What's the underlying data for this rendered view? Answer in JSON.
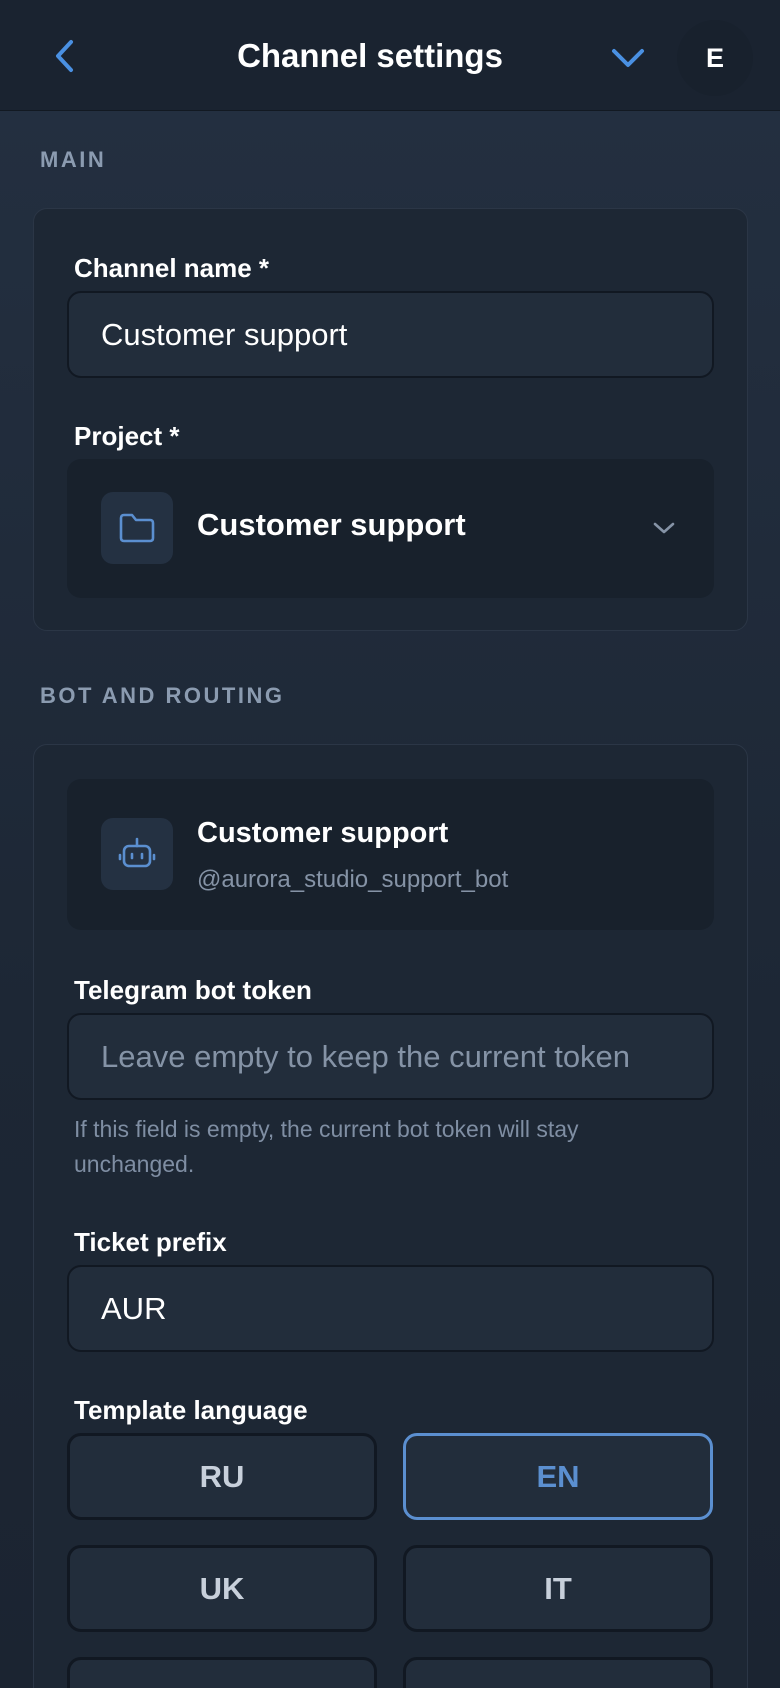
{
  "header": {
    "title": "Channel settings",
    "avatar_initial": "E"
  },
  "sections": {
    "main_label": "MAIN",
    "bot_label": "BOT AND ROUTING"
  },
  "main": {
    "channel_name_label": "Channel name *",
    "channel_name_value": "Customer support",
    "project_label": "Project *",
    "project_value": "Customer support"
  },
  "bot": {
    "name": "Customer support",
    "handle": "@aurora_studio_support_bot",
    "token_label": "Telegram bot token",
    "token_placeholder": "Leave empty to keep the current token",
    "token_hint": "If this field is empty, the current bot token will stay unchanged.",
    "prefix_label": "Ticket prefix",
    "prefix_value": "AUR",
    "language_label": "Template language",
    "languages": [
      {
        "code": "RU",
        "selected": false
      },
      {
        "code": "EN",
        "selected": true
      },
      {
        "code": "UK",
        "selected": false
      },
      {
        "code": "IT",
        "selected": false
      }
    ]
  },
  "colors": {
    "accent": "#5b8fd0",
    "background": "#1f2937",
    "card": "#1d2734"
  },
  "icons": {
    "back": "chevron-left-icon",
    "collapse": "chevron-down-icon",
    "project": "folder-icon",
    "bot": "robot-icon",
    "select": "chevron-down-icon"
  }
}
